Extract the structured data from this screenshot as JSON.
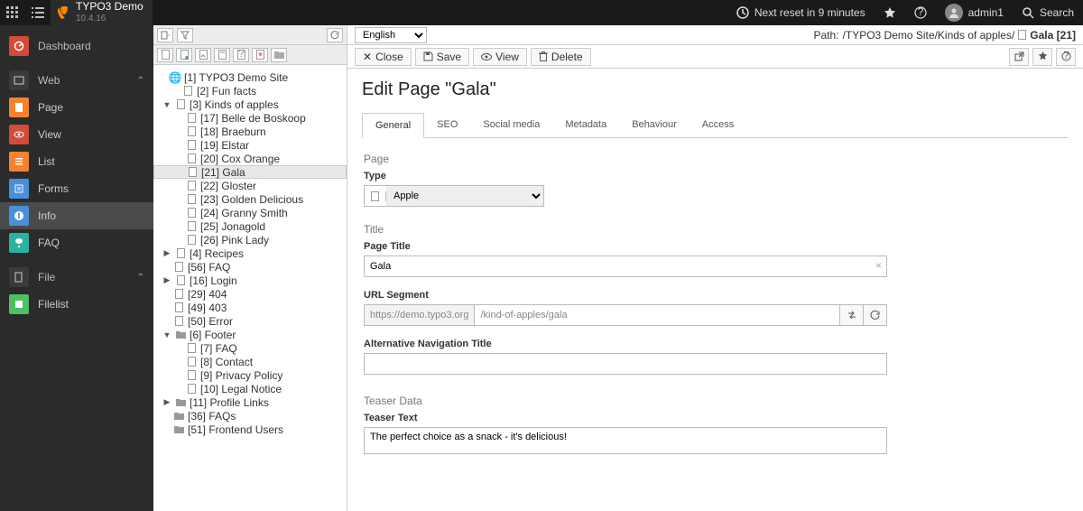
{
  "topbar": {
    "product": "TYPO3 Demo",
    "version": "10.4.16",
    "reset": "Next reset in 9 minutes",
    "user": "admin1",
    "search": "Search"
  },
  "modules": {
    "dashboard": "Dashboard",
    "web": "Web",
    "page": "Page",
    "view": "View",
    "list": "List",
    "forms": "Forms",
    "info": "Info",
    "faq": "FAQ",
    "file": "File",
    "filelist": "Filelist"
  },
  "tree": {
    "n1": "[1] TYPO3 Demo Site",
    "n2": "[2] Fun facts",
    "n3": "[3] Kinds of apples",
    "n17": "[17] Belle de Boskoop",
    "n18": "[18] Braeburn",
    "n19": "[19] Elstar",
    "n20": "[20] Cox Orange",
    "n21": "[21] Gala",
    "n22": "[22] Gloster",
    "n23": "[23] Golden Delicious",
    "n24": "[24] Granny Smith",
    "n25": "[25] Jonagold",
    "n26": "[26] Pink Lady",
    "n4": "[4] Recipes",
    "n56": "[56] FAQ",
    "n16": "[16] Login",
    "n29": "[29] 404",
    "n49": "[49] 403",
    "n50": "[50] Error",
    "n6": "[6] Footer",
    "n7": "[7] FAQ",
    "n8": "[8] Contact",
    "n9": "[9] Privacy Policy",
    "n10": "[10] Legal Notice",
    "n11": "[11] Profile Links",
    "n36": "[36] FAQs",
    "n51": "[51] Frontend Users"
  },
  "editor": {
    "language": "English",
    "path_label": "Path:",
    "path_value": "/TYPO3 Demo Site/Kinds of apples/",
    "path_current": "Gala [21]",
    "btn_close": "Close",
    "btn_save": "Save",
    "btn_view": "View",
    "btn_delete": "Delete",
    "heading": "Edit Page \"Gala\"",
    "tabs": {
      "general": "General",
      "seo": "SEO",
      "social": "Social media",
      "metadata": "Metadata",
      "behaviour": "Behaviour",
      "access": "Access"
    },
    "sec_page": "Page",
    "lbl_type": "Type",
    "type_value": "Apple",
    "sec_title": "Title",
    "lbl_pagetitle": "Page Title",
    "val_pagetitle": "Gala",
    "lbl_urlseg": "URL Segment",
    "url_prefix": "https://demo.typo3.org",
    "url_seg": "/kind-of-apples/gala",
    "lbl_altnav": "Alternative Navigation Title",
    "sec_teaser": "Teaser Data",
    "lbl_teaser": "Teaser Text",
    "val_teaser": "The perfect choice as a snack - it's delicious!"
  }
}
